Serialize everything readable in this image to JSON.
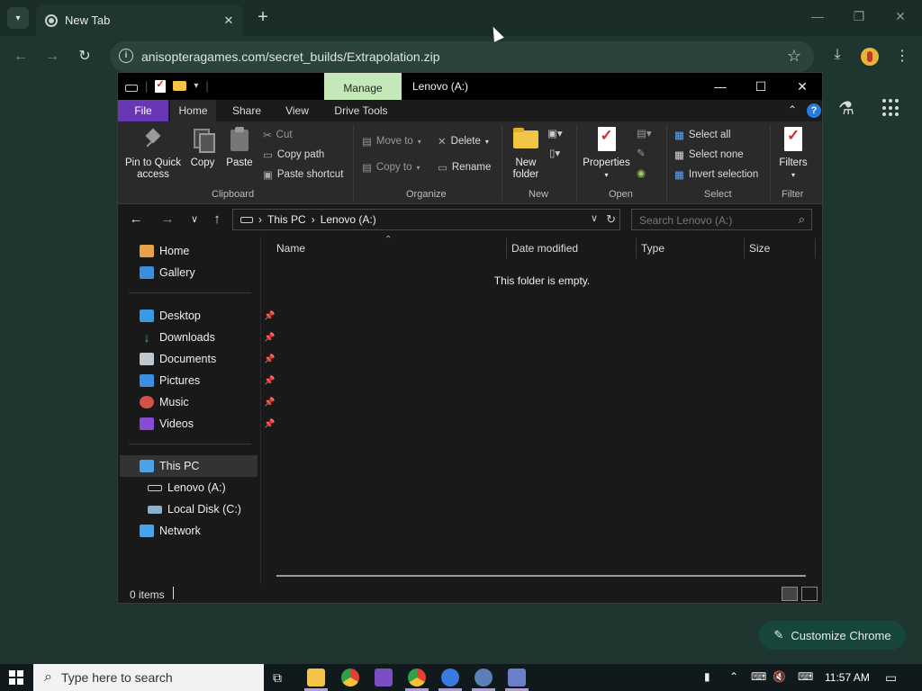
{
  "chrome": {
    "tab_title": "New Tab",
    "url": "anisopteragames.com/secret_builds/Extrapolation.zip",
    "customize_label": "Customize Chrome",
    "icons": [
      "chevron-down-icon",
      "chrome-favicon",
      "close-icon",
      "plus-icon",
      "back-icon",
      "forward-icon",
      "reload-icon",
      "info-icon",
      "star-icon",
      "download-icon",
      "profile-avatar",
      "menu-icon",
      "flask-icon",
      "apps-grid-icon",
      "pencil-icon"
    ]
  },
  "explorer": {
    "title": "Lenovo (A:)",
    "contextual_tab": "Manage",
    "ribbon_tabs": [
      "File",
      "Home",
      "Share",
      "View",
      "Drive Tools"
    ],
    "clipboard": {
      "pin": "Pin to Quick access",
      "copy": "Copy",
      "paste": "Paste",
      "cut": "Cut",
      "copy_path": "Copy path",
      "paste_shortcut": "Paste shortcut",
      "group": "Clipboard"
    },
    "organize": {
      "move_to": "Move to",
      "copy_to": "Copy to",
      "delete": "Delete",
      "rename": "Rename",
      "group": "Organize"
    },
    "new": {
      "new_folder": "New folder",
      "group": "New"
    },
    "open": {
      "properties": "Properties",
      "group": "Open"
    },
    "select": {
      "select_all": "Select all",
      "select_none": "Select none",
      "invert": "Invert selection",
      "group": "Select"
    },
    "filter": {
      "filters": "Filters",
      "group": "Filter"
    },
    "breadcrumb": [
      "This PC",
      "Lenovo (A:)"
    ],
    "search_placeholder": "Search Lenovo (A:)",
    "nav": {
      "home": "Home",
      "gallery": "Gallery",
      "desktop": "Desktop",
      "downloads": "Downloads",
      "documents": "Documents",
      "pictures": "Pictures",
      "music": "Music",
      "videos": "Videos",
      "this_pc": "This PC",
      "lenovo": "Lenovo (A:)",
      "local_disk": "Local Disk (C:)",
      "network": "Network"
    },
    "columns": [
      "Name",
      "Date modified",
      "Type",
      "Size"
    ],
    "empty_message": "This folder is empty.",
    "status": "0 items"
  },
  "taskbar": {
    "search_placeholder": "Type here to search",
    "time": "11:57 AM"
  }
}
